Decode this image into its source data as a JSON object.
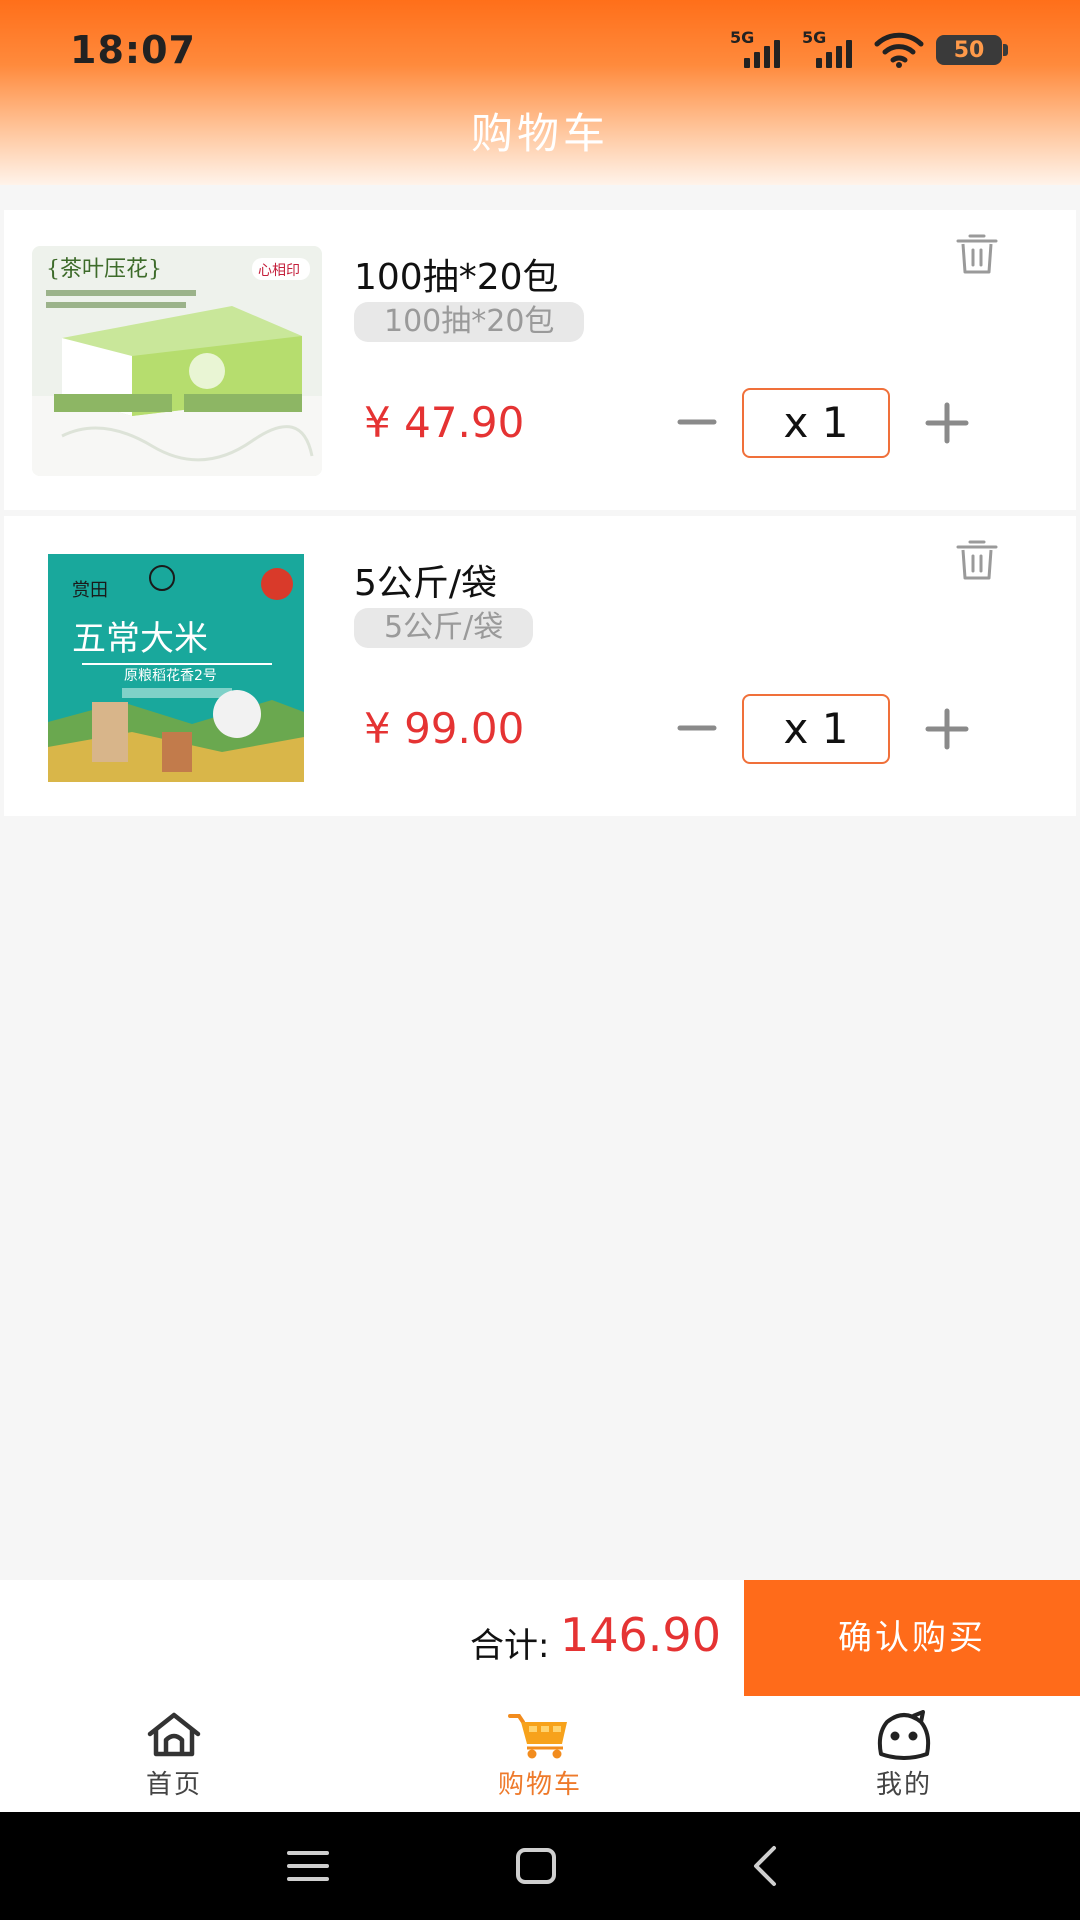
{
  "status_bar": {
    "time": "18:07",
    "signal_1": "5G",
    "signal_2": "5G",
    "battery": "50"
  },
  "header": {
    "title": "购物车"
  },
  "cart": {
    "items": [
      {
        "image": "tissue-pack-image",
        "name": "100抽*20包",
        "spec": "100抽*20包",
        "price": "¥ 47.90",
        "quantity": "x  1"
      },
      {
        "image": "rice-bag-image",
        "name": "5公斤/袋",
        "spec": "5公斤/袋",
        "price": "¥ 99.00",
        "quantity": "x  1"
      }
    ]
  },
  "checkout": {
    "total_label": "合计:",
    "total_value": "146.90",
    "buy_label": "确认购买"
  },
  "tabs": [
    {
      "label": "首页",
      "icon": "home-icon",
      "active": false
    },
    {
      "label": "购物车",
      "icon": "cart-icon",
      "active": true
    },
    {
      "label": "我的",
      "icon": "profile-face-icon",
      "active": false
    }
  ],
  "colors": {
    "accent": "#ff6b1a",
    "price": "#e53333",
    "active_tab": "#ee7a2b"
  }
}
